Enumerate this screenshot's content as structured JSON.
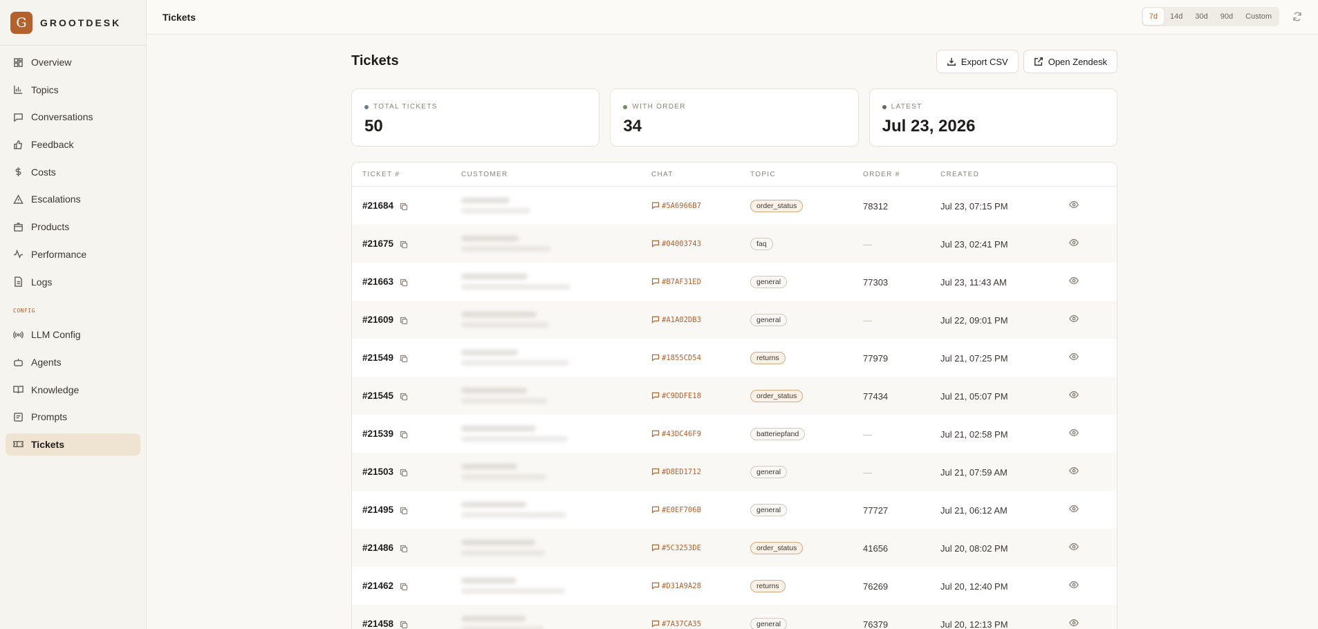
{
  "brand": {
    "letter": "G",
    "name": "GROOTDESK"
  },
  "sidebar": {
    "items": [
      {
        "label": "Overview",
        "icon": "grid-icon"
      },
      {
        "label": "Topics",
        "icon": "bar-chart-icon"
      },
      {
        "label": "Conversations",
        "icon": "message-icon"
      },
      {
        "label": "Feedback",
        "icon": "thumbs-up-icon"
      },
      {
        "label": "Costs",
        "icon": "dollar-icon"
      },
      {
        "label": "Escalations",
        "icon": "warning-icon"
      },
      {
        "label": "Products",
        "icon": "package-icon"
      },
      {
        "label": "Performance",
        "icon": "activity-icon"
      },
      {
        "label": "Logs",
        "icon": "file-icon"
      }
    ],
    "config_label": "CONFIG",
    "config_items": [
      {
        "label": "LLM Config",
        "icon": "radio-icon"
      },
      {
        "label": "Agents",
        "icon": "bot-icon"
      },
      {
        "label": "Knowledge",
        "icon": "book-icon"
      },
      {
        "label": "Prompts",
        "icon": "note-icon"
      },
      {
        "label": "Tickets",
        "icon": "ticket-icon",
        "active": true
      }
    ]
  },
  "topbar": {
    "title": "Tickets",
    "ranges": [
      "7d",
      "14d",
      "30d",
      "90d",
      "Custom"
    ],
    "active_range": "7d"
  },
  "page": {
    "title": "Tickets",
    "export_label": "Export CSV",
    "open_label": "Open Zendesk"
  },
  "stats": [
    {
      "label": "TOTAL TICKETS",
      "value": "50",
      "dot_color": "#6b7c8c"
    },
    {
      "label": "WITH ORDER",
      "value": "34",
      "dot_color": "#6b8f5e"
    },
    {
      "label": "LATEST",
      "value": "Jul 23, 2026",
      "dot_color": "#6b655d"
    }
  ],
  "table": {
    "headers": [
      "TICKET #",
      "CUSTOMER",
      "CHAT",
      "TOPIC",
      "ORDER #",
      "CREATED"
    ],
    "rows": [
      {
        "ticket": "#21684",
        "chat": "#5A6966B7",
        "topic": "order_status",
        "order": "78312",
        "created": "Jul 23, 07:15 PM"
      },
      {
        "ticket": "#21675",
        "chat": "#04003743",
        "topic": "faq",
        "order": "—",
        "created": "Jul 23, 02:41 PM"
      },
      {
        "ticket": "#21663",
        "chat": "#B7AF31ED",
        "topic": "general",
        "order": "77303",
        "created": "Jul 23, 11:43 AM"
      },
      {
        "ticket": "#21609",
        "chat": "#A1A02DB3",
        "topic": "general",
        "order": "—",
        "created": "Jul 22, 09:01 PM"
      },
      {
        "ticket": "#21549",
        "chat": "#1855CD54",
        "topic": "returns",
        "order": "77979",
        "created": "Jul 21, 07:25 PM"
      },
      {
        "ticket": "#21545",
        "chat": "#C9DDFE18",
        "topic": "order_status",
        "order": "77434",
        "created": "Jul 21, 05:07 PM"
      },
      {
        "ticket": "#21539",
        "chat": "#43DC46F9",
        "topic": "batteriepfand",
        "order": "—",
        "created": "Jul 21, 02:58 PM"
      },
      {
        "ticket": "#21503",
        "chat": "#D8ED1712",
        "topic": "general",
        "order": "—",
        "created": "Jul 21, 07:59 AM"
      },
      {
        "ticket": "#21495",
        "chat": "#E0EF706B",
        "topic": "general",
        "order": "77727",
        "created": "Jul 21, 06:12 AM"
      },
      {
        "ticket": "#21486",
        "chat": "#5C3253DE",
        "topic": "order_status",
        "order": "41656",
        "created": "Jul 20, 08:02 PM"
      },
      {
        "ticket": "#21462",
        "chat": "#D31A9A28",
        "topic": "returns",
        "order": "76269",
        "created": "Jul 20, 12:40 PM"
      },
      {
        "ticket": "#21458",
        "chat": "#7A37CA35",
        "topic": "general",
        "order": "76379",
        "created": "Jul 20, 12:13 PM"
      }
    ]
  }
}
